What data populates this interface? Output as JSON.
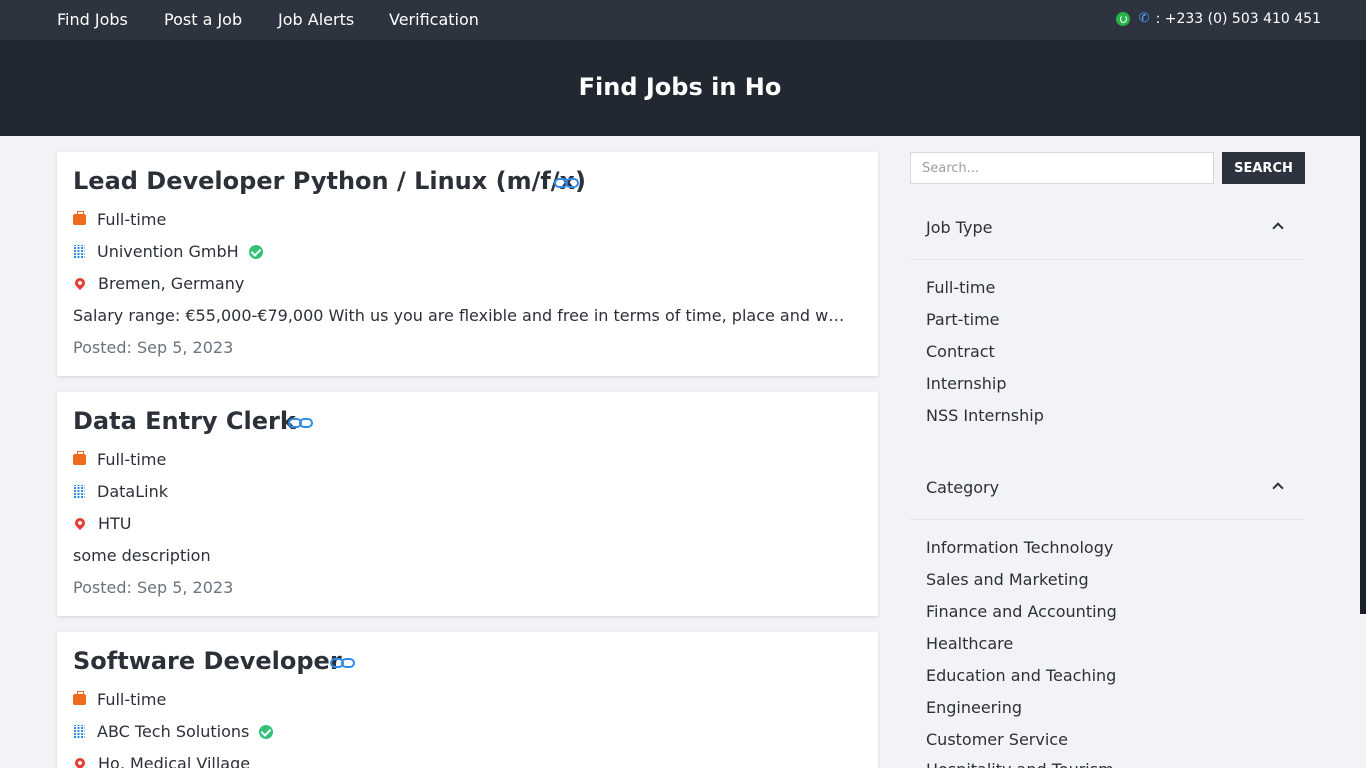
{
  "nav": {
    "links": [
      "Find Jobs",
      "Post a Job",
      "Job Alerts",
      "Verification"
    ],
    "phone": ": +233 (0) 503 410 451"
  },
  "hero": {
    "title": "Find Jobs in Ho"
  },
  "jobs": [
    {
      "title": "Lead Developer Python / Linux (m/f/x)",
      "type": "Full-time",
      "company": "Univention GmbH",
      "verified": true,
      "location": "Bremen, Germany",
      "description": "Salary range: €55,000-€79,000 With us you are flexible and free in terms of time, place and work...",
      "posted": "Posted: Sep 5, 2023"
    },
    {
      "title": "Data Entry Clerk",
      "type": "Full-time",
      "company": "DataLink",
      "verified": false,
      "location": "HTU",
      "description": "some description",
      "posted": "Posted: Sep 5, 2023"
    },
    {
      "title": "Software Developer",
      "type": "Full-time",
      "company": "ABC Tech Solutions",
      "verified": true,
      "location": "Ho, Medical Village"
    }
  ],
  "sidebar": {
    "search": {
      "placeholder": "Search...",
      "button": "SEARCH"
    },
    "job_type": {
      "title": "Job Type",
      "items": [
        "Full-time",
        "Part-time",
        "Contract",
        "Internship",
        "NSS Internship"
      ]
    },
    "category": {
      "title": "Category",
      "items": [
        "Information Technology",
        "Sales and Marketing",
        "Finance and Accounting",
        "Healthcare",
        "Education and Teaching",
        "Engineering",
        "Customer Service",
        "Hospitality and Tourism"
      ]
    }
  },
  "colors": {
    "nav_bg": "#2d333f",
    "hero_bg": "#222831",
    "accent_blue": "#2f8ae8",
    "verified_green": "#34c27a",
    "bag_orange": "#ef6c1e",
    "pin_red": "#e53935"
  }
}
